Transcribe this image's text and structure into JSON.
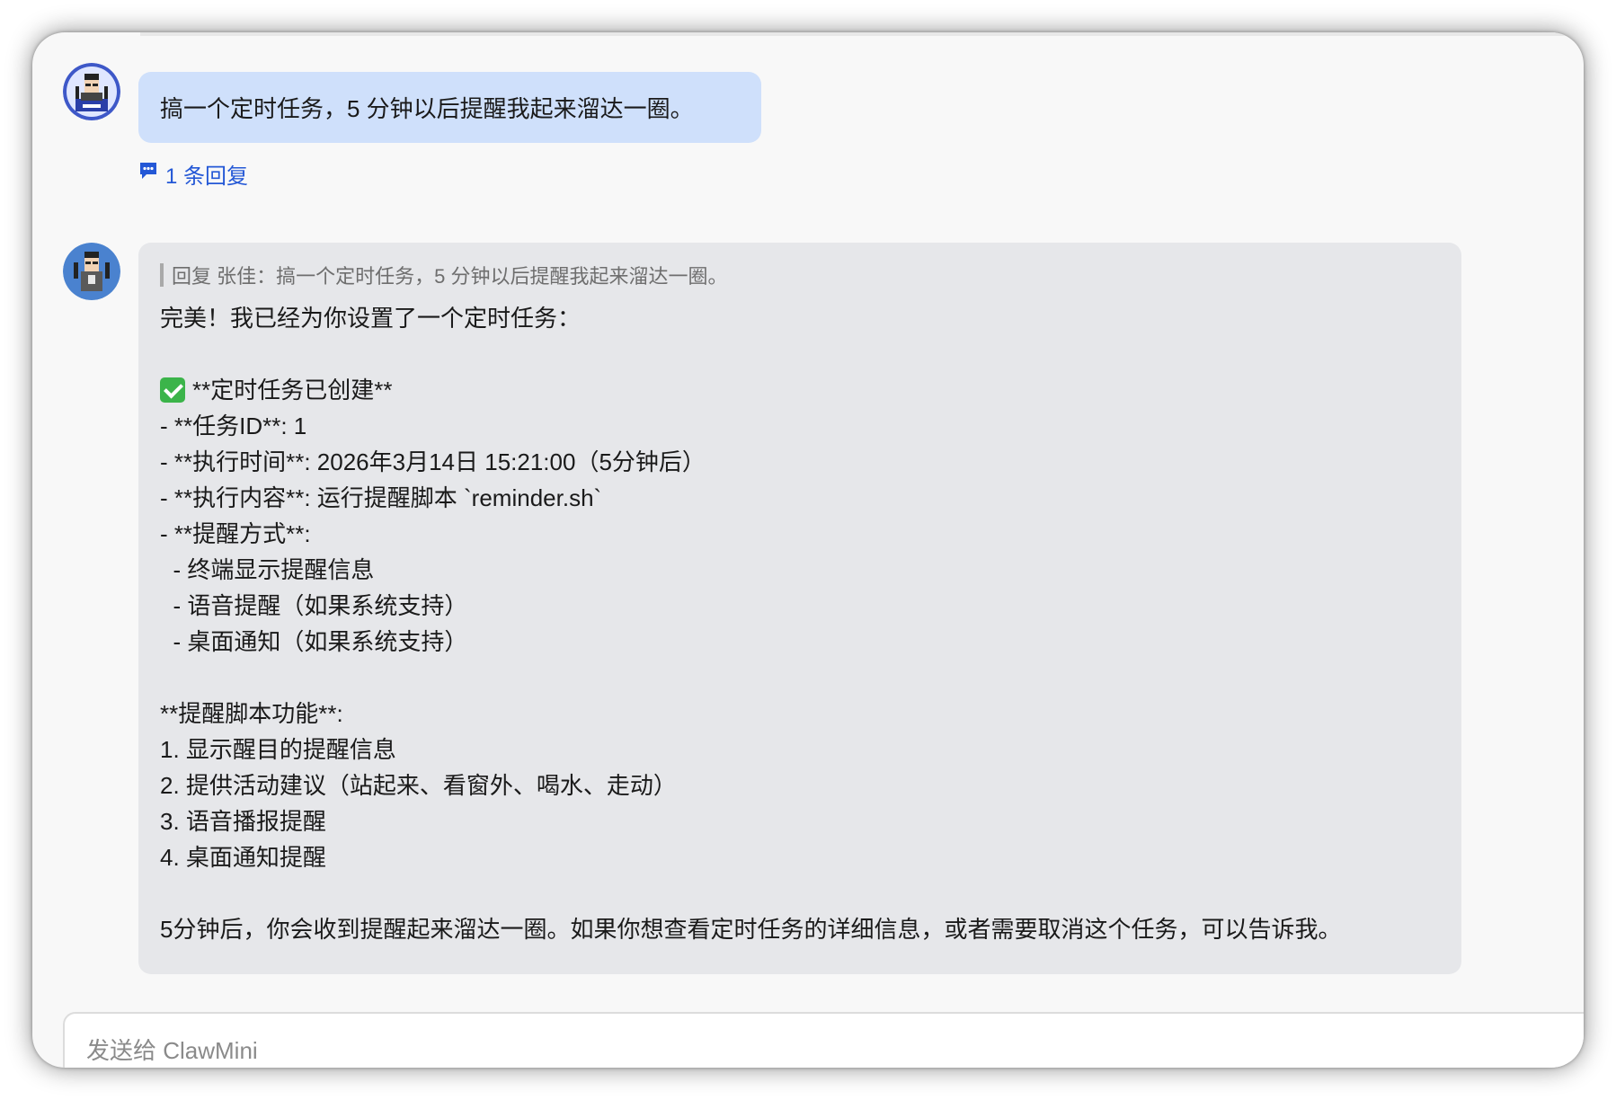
{
  "conversation": {
    "user_message": {
      "avatar_icon": "user-avatar-icon",
      "text": "搞一个定时任务，5 分钟以后提醒我起来溜达一圈。",
      "reply_count_label": "1 条回复",
      "bubble_color": "#cfe0fb"
    },
    "bot_message": {
      "avatar_icon": "bot-avatar-icon",
      "quote": "回复 张佳：搞一个定时任务，5 分钟以后提醒我起来溜达一圈。",
      "bubble_color": "#e6e7ea",
      "lines": [
        "完美！我已经为你设置了一个定时任务：",
        "",
        "**定时任务已创建**",
        "- **任务ID**: 1",
        "- **执行时间**: 2026年3月14日 15:21:00（5分钟后）",
        "- **执行内容**: 运行提醒脚本 `reminder.sh`",
        "- **提醒方式**:",
        "  - 终端显示提醒信息",
        "  - 语音提醒（如果系统支持）",
        "  - 桌面通知（如果系统支持）",
        "",
        "**提醒脚本功能**:",
        "1. 显示醒目的提醒信息",
        "2. 提供活动建议（站起来、看窗外、喝水、走动）",
        "3. 语音播报提醒",
        "4. 桌面通知提醒",
        "",
        "5分钟后，你会收到提醒起来溜达一圈。如果你想查看定时任务的详细信息，或者需要取消这个任务，可以告诉我。"
      ]
    }
  },
  "composer": {
    "placeholder": "发送给 ClawMini"
  },
  "colors": {
    "reply_link": "#2458d6",
    "checkmark": "#3bb44a"
  }
}
